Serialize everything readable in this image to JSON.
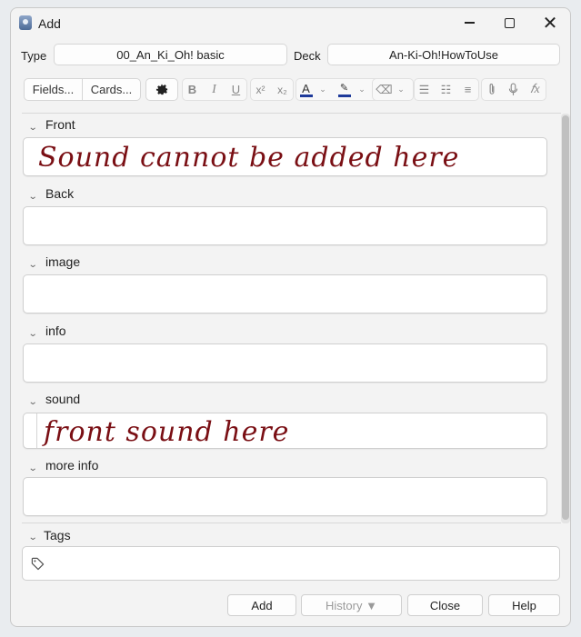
{
  "window": {
    "title": "Add"
  },
  "selectors": {
    "type_label": "Type",
    "type_value": "00_An_Ki_Oh! basic",
    "deck_label": "Deck",
    "deck_value": "An-Ki-Oh!HowToUse"
  },
  "toolbar": {
    "fields_label": "Fields...",
    "cards_label": "Cards...",
    "icons": [
      "gear-icon",
      "bold-icon",
      "italic-icon",
      "underline-icon",
      "superscript-icon",
      "subscript-icon",
      "text-color-icon",
      "highlight-icon",
      "eraser-icon",
      "bullet-list-icon",
      "numbered-list-icon",
      "align-icon",
      "attach-icon",
      "microphone-icon",
      "formula-icon"
    ],
    "text_color": "#1e3a9a",
    "highlight_color": "#1e3a9a"
  },
  "fields": [
    {
      "label": "Front",
      "content": "Sound cannot be added here"
    },
    {
      "label": "Back",
      "content": ""
    },
    {
      "label": "image",
      "content": ""
    },
    {
      "label": "info",
      "content": ""
    },
    {
      "label": "sound",
      "content": "front  sound  here"
    },
    {
      "label": "more info",
      "content": ""
    }
  ],
  "tags": {
    "label": "Tags"
  },
  "buttons": {
    "add": "Add",
    "history": "History ▼",
    "close": "Close",
    "help": "Help"
  },
  "colors": {
    "ink": "#7a0f14"
  }
}
